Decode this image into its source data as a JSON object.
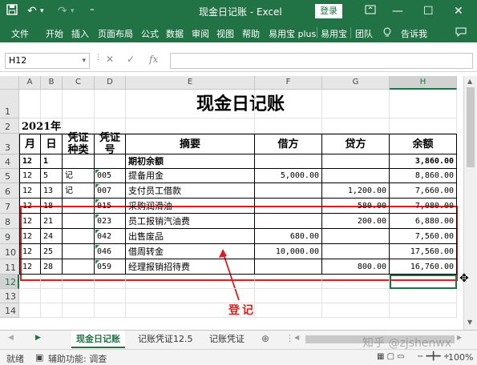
{
  "titlebar": {
    "title": "现金日记账 - Excel",
    "login_label": "登录",
    "save_icon": "save-icon",
    "undo_icon": "undo-icon",
    "redo_icon": "redo-icon"
  },
  "ribbon": {
    "tabs": [
      "文件",
      "开始",
      "插入",
      "页面布局",
      "公式",
      "数据",
      "审阅",
      "视图",
      "帮助",
      "易用宝 plus",
      "易用宝",
      "团队",
      "告诉我"
    ]
  },
  "formula_bar": {
    "name_box": "H12",
    "fx_label": "fx",
    "value": ""
  },
  "columns": [
    "A",
    "B",
    "C",
    "D",
    "E",
    "F",
    "G",
    "H"
  ],
  "rows": [
    "1",
    "2",
    "3",
    "4",
    "5",
    "6",
    "7",
    "8",
    "9",
    "10",
    "11",
    "12",
    "13",
    "14"
  ],
  "sheet": {
    "title": "现金日记账",
    "year": "2021年",
    "headers": {
      "month": "月",
      "day": "日",
      "voucher_type": "凭证种类",
      "voucher_no": "凭证号",
      "summary": "摘要",
      "debit": "借方",
      "credit": "贷方",
      "balance": "余额"
    },
    "records": [
      {
        "month": "12",
        "day": "1",
        "type": "",
        "no": "",
        "summary": "期初余额",
        "debit": "",
        "credit": "",
        "balance": "3,860.00"
      },
      {
        "month": "12",
        "day": "5",
        "type": "记",
        "no": "005",
        "summary": "提备用金",
        "debit": "5,000.00",
        "credit": "",
        "balance": "8,860.00"
      },
      {
        "month": "12",
        "day": "13",
        "type": "记",
        "no": "007",
        "summary": "支付员工借款",
        "debit": "",
        "credit": "1,200.00",
        "balance": "7,660.00"
      },
      {
        "month": "12",
        "day": "18",
        "type": "",
        "no": "015",
        "summary": "采购润滑油",
        "debit": "",
        "credit": "580.00",
        "balance": "7,080.00"
      },
      {
        "month": "12",
        "day": "21",
        "type": "",
        "no": "023",
        "summary": "员工报销汽油费",
        "debit": "",
        "credit": "200.00",
        "balance": "6,880.00"
      },
      {
        "month": "12",
        "day": "24",
        "type": "",
        "no": "042",
        "summary": "出售废品",
        "debit": "680.00",
        "credit": "",
        "balance": "7,560.00"
      },
      {
        "month": "12",
        "day": "25",
        "type": "",
        "no": "046",
        "summary": "借周转金",
        "debit": "10,000.00",
        "credit": "",
        "balance": "17,560.00"
      },
      {
        "month": "12",
        "day": "28",
        "type": "",
        "no": "059",
        "summary": "经理报销招待费",
        "debit": "",
        "credit": "800.00",
        "balance": "16,760.00"
      }
    ]
  },
  "annotation": {
    "label": "登记",
    "color": "#e21a1a"
  },
  "sheet_tabs": [
    "现金日记账",
    "记账凭证12.5",
    "记账凭证"
  ],
  "status": {
    "ready": "就绪",
    "accessibility": "辅助功能: 调查",
    "zoom": "100%"
  },
  "watermark": "知乎 @zjshenwx",
  "colors": {
    "excel_green": "#217346",
    "annotation_red": "#e21a1a"
  }
}
